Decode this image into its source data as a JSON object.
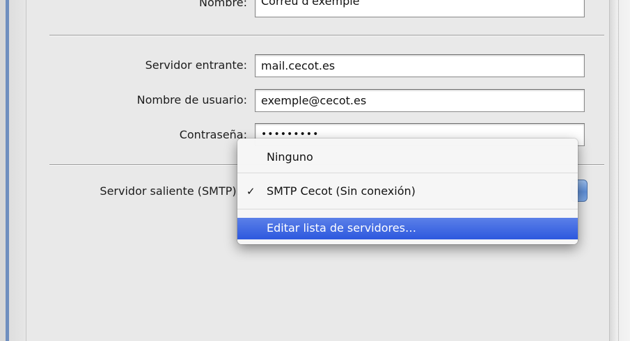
{
  "account": {
    "name_label": "Nombre:",
    "name_value": "Correu d'exemple",
    "incoming_label": "Servidor entrante:",
    "incoming_value": "mail.cecot.es",
    "username_label": "Nombre de usuario:",
    "username_value": "exemple@cecot.es",
    "password_label": "Contraseña:",
    "password_value": "•••••••••",
    "smtp_label": "Servidor saliente (SMTP):"
  },
  "smtp_menu": {
    "items": [
      {
        "label": "Ninguno",
        "checked": false,
        "selected": false
      },
      {
        "label": "SMTP Cecot (Sin conexión)",
        "checked": true,
        "selected": false
      },
      {
        "label": "Editar lista de servidores…",
        "checked": false,
        "selected": true
      }
    ],
    "check_glyph": "✓",
    "highlight_color": "#3a63e0"
  }
}
